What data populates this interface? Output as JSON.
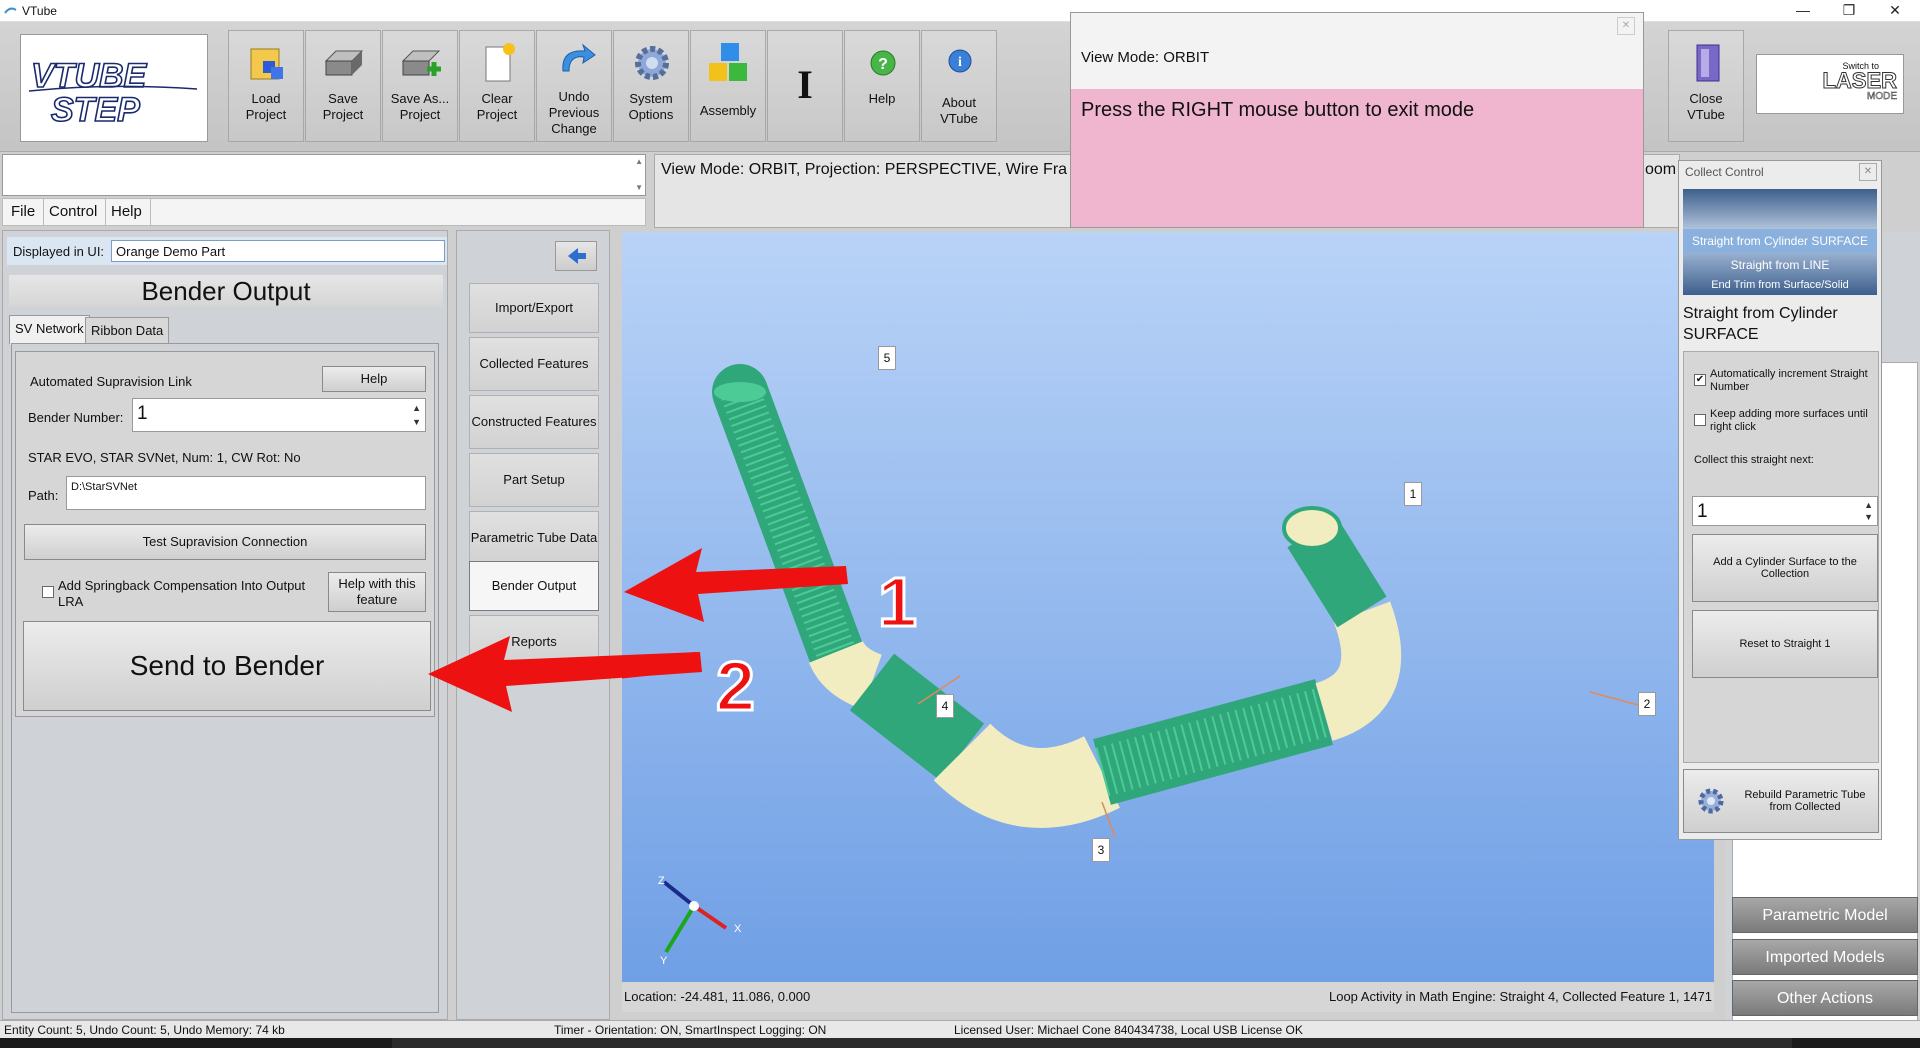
{
  "window": {
    "title": "VTube",
    "minimize": "—",
    "restore": "❐",
    "close": "✕"
  },
  "toolbar": {
    "logo_text": "VTUBE STEP",
    "buttons": [
      {
        "label": "Load\nProject"
      },
      {
        "label": "Save\nProject"
      },
      {
        "label": "Save As...\nProject"
      },
      {
        "label": "Clear\nProject"
      },
      {
        "label": "Undo\nPrevious\nChange"
      },
      {
        "label": "System\nOptions"
      },
      {
        "label": "Assembly"
      },
      {
        "label": "I"
      },
      {
        "label": "Help"
      },
      {
        "label": "About\nVTube"
      }
    ],
    "close_label": "Close\nVTube",
    "laser_small": "Switch to",
    "laser_big": "LASER",
    "laser_mode": "MODE"
  },
  "viewmode_popup": {
    "header": "View Mode: ORBIT",
    "message": "Press the RIGHT mouse button to exit mode"
  },
  "status_line": "View Mode: ORBIT, Projection: PERSPECTIVE, Wire Fra",
  "status_line_tail": "oom",
  "menu": [
    "File",
    "Control",
    "Help"
  ],
  "left": {
    "displayed_label": "Displayed in UI:",
    "displayed_value": "Orange Demo Part",
    "header": "Bender Output",
    "tabs": [
      "SV Network",
      "Ribbon Data"
    ],
    "auto_link": "Automated Supravision Link",
    "help_btn": "Help",
    "bender_number_label": "Bender Number:",
    "bender_number": "1",
    "info": "STAR EVO, STAR SVNet, Num: 1, CW Rot: No",
    "path_label": "Path:",
    "path_value": "D:\\StarSVNet",
    "test_btn": "Test Supravision Connection",
    "springback_label": "Add Springback Compensation Into Output LRA",
    "help_feature_btn": "Help with this feature",
    "send_btn": "Send to Bender"
  },
  "mid": {
    "items": [
      "Import/Export",
      "Collected Features",
      "Constructed Features",
      "Part Setup",
      "Parametric Tube Data",
      "Bender Output",
      "Reports"
    ]
  },
  "viewport": {
    "location": "Location: -24.481, 11.086, 0.000",
    "loop_activity": "Loop Activity in Math Engine:  Straight 4, Collected Feature 1, 1471",
    "callouts": [
      "1",
      "2",
      "3",
      "4",
      "5"
    ],
    "arrow_labels": [
      "1",
      "2"
    ],
    "axes": [
      "Z",
      "X",
      "Y"
    ]
  },
  "collect": {
    "title": "Collect Control",
    "list": [
      "Straight from Cylinder SURFACE",
      "Straight from LINE",
      "End   Trim from Surface/Solid"
    ],
    "heading": "Straight from Cylinder SURFACE",
    "auto_inc": "Automatically increment Straight Number",
    "keep_adding": "Keep adding more surfaces until right click",
    "collect_next": "Collect this straight next:",
    "next_value": "1",
    "add_btn": "Add a Cylinder Surface to the Collection",
    "reset_btn": "Reset to Straight 1",
    "rebuild_btn": "Rebuild Parametric Tube from Collected"
  },
  "right_buttons": [
    "Parametric Model",
    "Imported Models",
    "Other Actions"
  ],
  "bottom": {
    "a": "Entity Count: 5, Undo Count: 5, Undo Memory: 74 kb",
    "b": "Timer - Orientation: ON, SmartInspect Logging: ON",
    "c": "Licensed User: Michael Cone 840434738, Local USB License OK"
  },
  "colors": {
    "tube": "#3cbf8c",
    "bend": "#f3efc0",
    "pink": "#f0b6cf",
    "arrow": "#ee1111"
  }
}
